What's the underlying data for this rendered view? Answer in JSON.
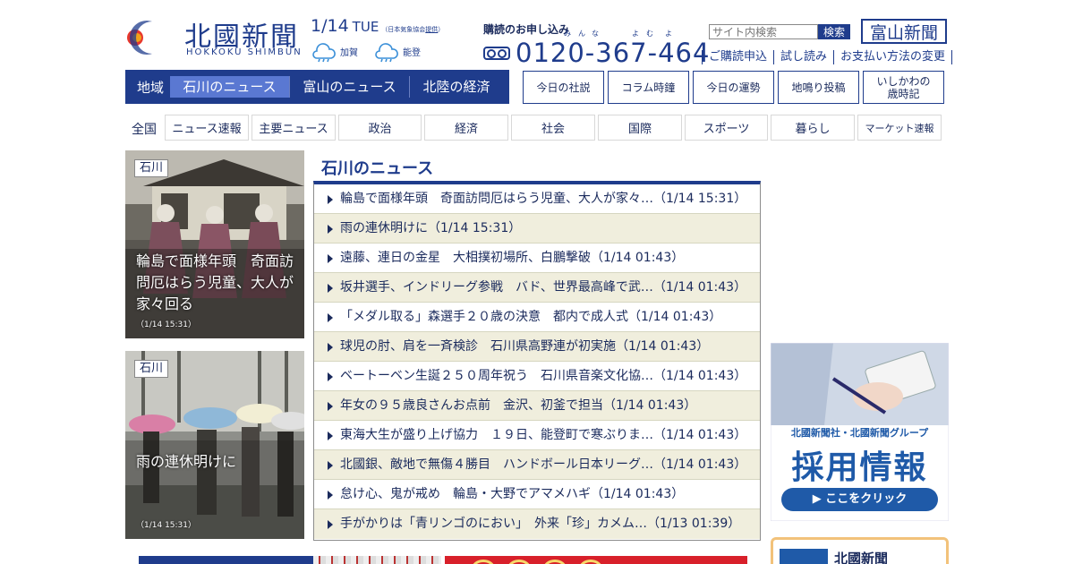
{
  "header": {
    "logo_kanji": "北國新聞",
    "logo_roman": "HOKKOKU SHIMBUN",
    "date": "1/14",
    "dow": "TUE",
    "note_prefix": "（日本気象協会",
    "note_link": "提供",
    "note_suffix": "）",
    "weather": [
      {
        "area": "加賀",
        "icon": "rain-icon"
      },
      {
        "area": "能登",
        "icon": "rain-icon"
      }
    ],
    "subscribe_label": "購読のお申し込み",
    "ruby": [
      "み",
      "ん",
      "な",
      "よ",
      "む",
      "よ"
    ],
    "phone": "0120-367-464",
    "search_placeholder": "サイト内検索",
    "search_button": "検索",
    "toyama_button": "富山新聞",
    "links": [
      "ご購読申込",
      "試し読み",
      "お支払い方法の変更"
    ]
  },
  "region_nav": {
    "label": "地域",
    "tabs": [
      {
        "label": "石川のニュース",
        "active": true
      },
      {
        "label": "富山のニュース",
        "active": false
      },
      {
        "label": "北陸の経済",
        "active": false
      }
    ]
  },
  "feature_buttons": [
    "今日の社説",
    "コラム時鐘",
    "今日の運勢",
    "地鳴り投稿"
  ],
  "feature_button_last": [
    "いしかわの",
    "歳時記"
  ],
  "category_nav": {
    "label": "全国",
    "items": [
      "ニュース速報",
      "主要ニュース",
      "政治",
      "経済",
      "社会",
      "国際",
      "スポーツ",
      "暮らし",
      "マーケット速報"
    ]
  },
  "photos": [
    {
      "tag": "石川",
      "caption_lines": [
        "輪島で面様年頭　奇面訪",
        "問厄はらう児童、大人が",
        "家々回る"
      ],
      "time": "（1/14 15:31）"
    },
    {
      "tag": "石川",
      "caption_lines": [
        "雨の連休明けに"
      ],
      "time": "（1/14 15:31）"
    }
  ],
  "news": {
    "title": "石川のニュース",
    "items": [
      "輪島で面様年頭　奇面訪問厄はらう児童、大人が家々…（1/14 15:31）",
      "雨の連休明けに（1/14 15:31）",
      "遠藤、連日の金星　大相撲初場所、白鵬撃破（1/14 01:43）",
      "坂井選手、インドリーグ参戦　バド、世界最高峰で武…（1/14 01:43）",
      "「メダル取る」森選手２０歳の決意　都内で成人式（1/14 01:43）",
      "球児の肘、肩を一斉検診　石川県高野連が初実施（1/14 01:43）",
      "ベートーベン生誕２５０周年祝う　石川県音楽文化協…（1/14 01:43）",
      "年女の９５歳良さんお点前　金沢、初釜で担当（1/14 01:43）",
      "東海大生が盛り上げ協力　１９日、能登町で寒ぶりま…（1/14 01:43）",
      "北國銀、敵地で無傷４勝目　ハンドボール日本リーグ…（1/14 01:43）",
      "怠け心、鬼が戒め　輪島・大野でアマメハギ（1/14 01:43）",
      "手がかりは「青リンゴのにおい」　外来「珍」カメム…（1/13 01:39）"
    ]
  },
  "ad": {
    "line1": "北國新聞社・北國新聞グループ",
    "line2": "採用情報",
    "button": "▶ ここをクリック"
  },
  "ad_bottom_title": "北國新聞",
  "colors": {
    "brand": "#1f3c8c",
    "active_tab": "#5a78d2",
    "row_alt": "#f0eedd"
  }
}
